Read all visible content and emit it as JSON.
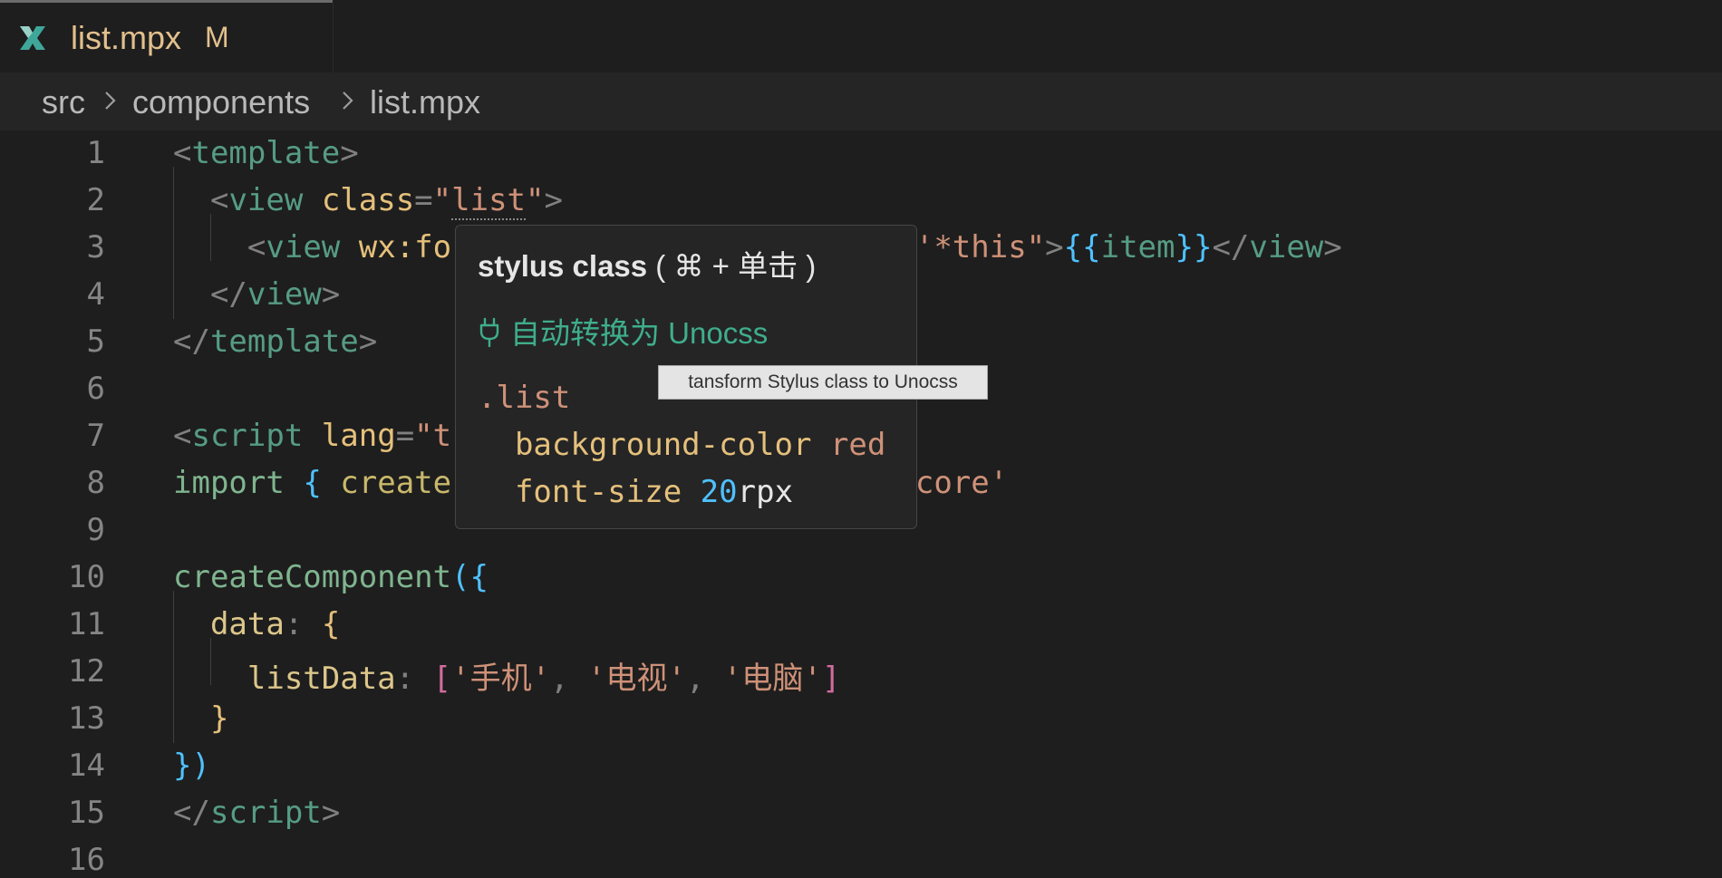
{
  "tab": {
    "filename": "list.mpx",
    "status": "M",
    "icon": "mpx-file-icon"
  },
  "breadcrumb": {
    "items": [
      "src",
      "components",
      "list.mpx"
    ]
  },
  "editor": {
    "line_numbers": [
      "1",
      "2",
      "3",
      "4",
      "5",
      "6",
      "7",
      "8",
      "9",
      "10",
      "11",
      "12",
      "13",
      "14",
      "15",
      "16"
    ]
  },
  "hover": {
    "title": "stylus class",
    "shortcut": "( ⌘ + 单击 )",
    "action": "自动转换为 Unocss",
    "snippet_selector": ".list",
    "snippet_prop1": "background-color",
    "snippet_val1": "red",
    "snippet_prop2": "font-size",
    "snippet_num2": "20",
    "snippet_unit2": "rpx"
  },
  "tooltip": {
    "text": "tansform Stylus class to Unocss"
  },
  "colors": {
    "background": "#1e1e1e",
    "tab_modified": "#e2c08d",
    "tag": "#569c84",
    "string": "#ce9178",
    "hover_bg": "#252526",
    "action": "#3fae8a"
  }
}
